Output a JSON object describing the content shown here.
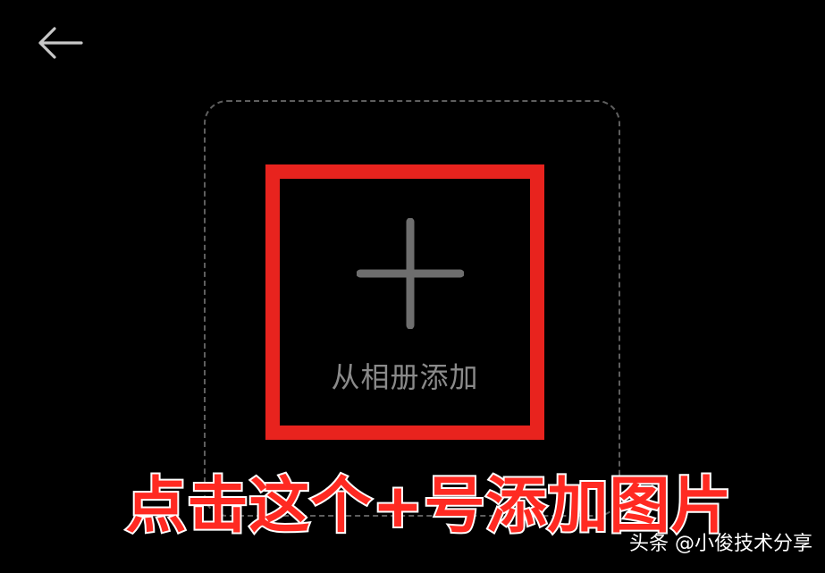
{
  "header": {
    "back_icon": "arrow-left-icon"
  },
  "picker": {
    "add_icon": "plus-icon",
    "add_label": "从相册添加"
  },
  "caption": {
    "text": "点击这个+号添加图片"
  },
  "watermark": {
    "text": "头条 @小俊技术分享"
  },
  "colors": {
    "background": "#000000",
    "highlight": "#e8231e",
    "dashed_border": "#5e5e5e",
    "plus": "#6e6e6e",
    "label": "#8a8a8a",
    "caption": "#ff2a22"
  }
}
